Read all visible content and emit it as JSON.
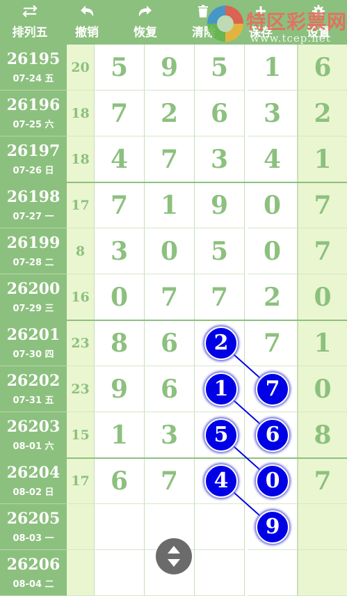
{
  "toolbar": {
    "buttons": [
      {
        "label": "排列五",
        "icon": "swap-arrows-icon"
      },
      {
        "label": "撤销",
        "icon": "undo-icon"
      },
      {
        "label": "恢复",
        "icon": "redo-icon"
      },
      {
        "label": "清除",
        "icon": "trash-icon"
      },
      {
        "label": "保存",
        "icon": "plus-icon"
      },
      {
        "label": "设置",
        "icon": "gear-icon"
      }
    ],
    "watermark": {
      "brand": "特区彩票网",
      "url": "www.tcep.net"
    }
  },
  "rows": [
    {
      "issue": "26195",
      "date": "07-24 五",
      "sum": "20",
      "digits": [
        "5",
        "9",
        "5",
        "1",
        "6"
      ]
    },
    {
      "issue": "26196",
      "date": "07-25 六",
      "sum": "18",
      "digits": [
        "7",
        "2",
        "6",
        "3",
        "2"
      ]
    },
    {
      "issue": "26197",
      "date": "07-26 日",
      "sum": "18",
      "digits": [
        "4",
        "7",
        "3",
        "4",
        "1"
      ]
    },
    {
      "issue": "26198",
      "date": "07-27 一",
      "sum": "17",
      "digits": [
        "7",
        "1",
        "9",
        "0",
        "7"
      ]
    },
    {
      "issue": "26199",
      "date": "07-28 二",
      "sum": "8",
      "digits": [
        "3",
        "0",
        "5",
        "0",
        "7"
      ]
    },
    {
      "issue": "26200",
      "date": "07-29 三",
      "sum": "16",
      "digits": [
        "0",
        "7",
        "7",
        "2",
        "0"
      ]
    },
    {
      "issue": "26201",
      "date": "07-30 四",
      "sum": "23",
      "digits": [
        "8",
        "6",
        "",
        "7",
        "1"
      ]
    },
    {
      "issue": "26202",
      "date": "07-31 五",
      "sum": "23",
      "digits": [
        "9",
        "6",
        "",
        "",
        "0"
      ]
    },
    {
      "issue": "26203",
      "date": "08-01 六",
      "sum": "15",
      "digits": [
        "1",
        "3",
        "",
        "",
        "8"
      ]
    },
    {
      "issue": "26204",
      "date": "08-02 日",
      "sum": "17",
      "digits": [
        "6",
        "7",
        "",
        "",
        "7"
      ]
    },
    {
      "issue": "26205",
      "date": "08-03 一",
      "sum": "",
      "digits": [
        "",
        "",
        "",
        "",
        ""
      ]
    },
    {
      "issue": "26206",
      "date": "08-04 二",
      "sum": "",
      "digits": [
        "",
        "",
        "",
        "",
        ""
      ]
    }
  ],
  "marked_balls": [
    {
      "row": 6,
      "col": 2,
      "value": "2"
    },
    {
      "row": 7,
      "col": 3,
      "value": "7"
    },
    {
      "row": 7,
      "col": 2,
      "value": "1"
    },
    {
      "row": 8,
      "col": 3,
      "value": "6"
    },
    {
      "row": 8,
      "col": 2,
      "value": "5"
    },
    {
      "row": 9,
      "col": 3,
      "value": "0"
    },
    {
      "row": 9,
      "col": 2,
      "value": "4"
    },
    {
      "row": 10,
      "col": 3,
      "value": "9"
    }
  ],
  "scroll_button": {
    "icon": "up-down-arrows-icon"
  },
  "colors": {
    "header_green": "#8cc07e",
    "ball_blue": "#0000e6",
    "light_column": "#eaf6d0"
  }
}
